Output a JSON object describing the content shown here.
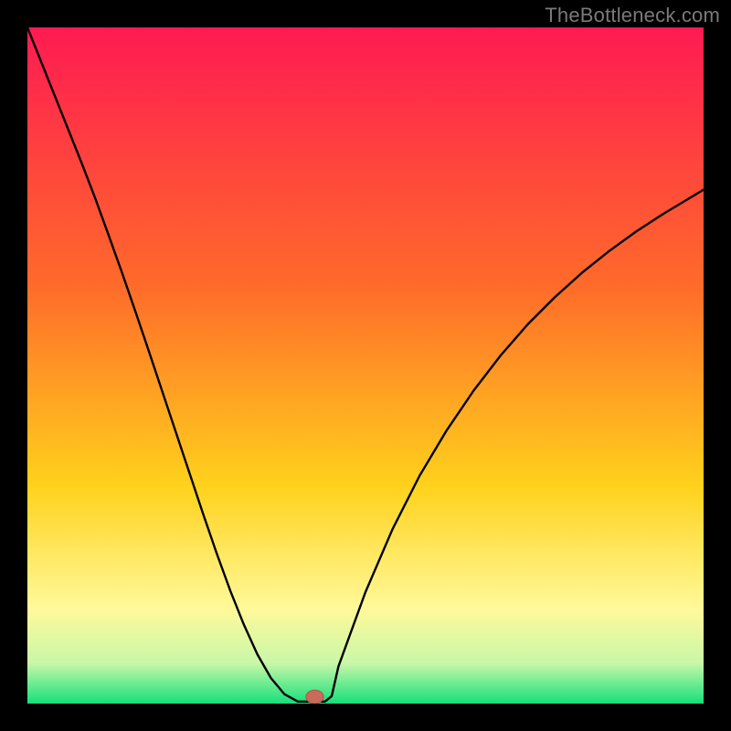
{
  "watermark": "TheBottleneck.com",
  "colors": {
    "bg": "#000000",
    "grad_top": "#ff1a52",
    "grad_mid1": "#ff6a2a",
    "grad_mid2": "#ffd21c",
    "grad_low1": "#fff99a",
    "grad_low2": "#c9f7a8",
    "grad_bottom": "#15e07a",
    "curve": "#000000",
    "marker_fill": "#c96b5a",
    "marker_stroke": "#b05444"
  },
  "chart_data": {
    "type": "line",
    "title": "",
    "xlabel": "",
    "ylabel": "",
    "xlim": [
      0,
      1
    ],
    "ylim": [
      0,
      1
    ],
    "x": [
      0.0,
      0.02,
      0.04,
      0.06,
      0.08,
      0.1,
      0.12,
      0.14,
      0.16,
      0.18,
      0.2,
      0.22,
      0.24,
      0.26,
      0.28,
      0.3,
      0.32,
      0.34,
      0.36,
      0.38,
      0.4,
      0.41,
      0.42,
      0.43,
      0.44,
      0.45,
      0.46,
      0.5,
      0.54,
      0.58,
      0.62,
      0.66,
      0.7,
      0.74,
      0.78,
      0.82,
      0.86,
      0.9,
      0.94,
      0.98,
      1.0
    ],
    "values": [
      1.0,
      0.95,
      0.9,
      0.85,
      0.8,
      0.748,
      0.693,
      0.637,
      0.579,
      0.52,
      0.46,
      0.4,
      0.34,
      0.28,
      0.222,
      0.167,
      0.117,
      0.073,
      0.038,
      0.014,
      0.003,
      0.003,
      0.003,
      0.003,
      0.003,
      0.011,
      0.055,
      0.165,
      0.258,
      0.337,
      0.404,
      0.463,
      0.515,
      0.561,
      0.601,
      0.637,
      0.669,
      0.698,
      0.724,
      0.748,
      0.76
    ],
    "marker": {
      "x": 0.425,
      "y": 0.01,
      "rx": 0.013,
      "ry": 0.01
    },
    "notes": "Axes are implicit/unlabeled; values expressed in normalized 0–1 over the plot area. The curve is a V-shape with minimum near x≈0.42."
  }
}
